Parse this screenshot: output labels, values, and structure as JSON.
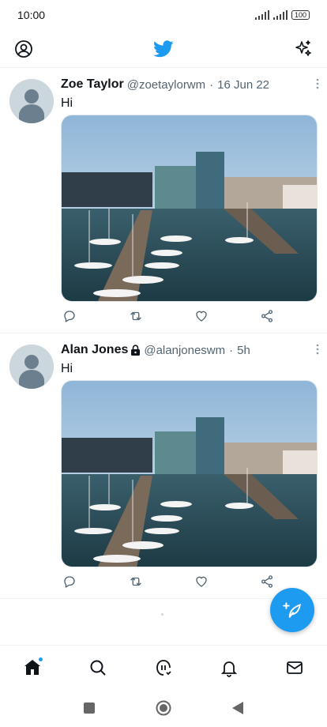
{
  "status_bar": {
    "time": "10:00",
    "battery": "100",
    "icons": [
      "signal-icon",
      "signal-icon",
      "battery-icon"
    ]
  },
  "app_bar": {
    "left_icon": "profile-icon",
    "center_icon": "twitter-bird-icon",
    "right_icon": "sparkle-icon"
  },
  "tweets": [
    {
      "name": "Zoe Taylor",
      "handle": "@zoetaylorwm",
      "dot": "·",
      "time": "16 Jun 22",
      "text": "Hi",
      "locked": false,
      "media": "harbor-photo"
    },
    {
      "name": "Alan Jones",
      "handle": "@alanjoneswm",
      "dot": "·",
      "time": "5h",
      "text": "Hi",
      "locked": true,
      "media": "harbor-photo"
    }
  ],
  "actions": [
    "reply-icon",
    "retweet-icon",
    "like-icon",
    "share-icon"
  ],
  "fab": {
    "icon": "compose-icon"
  },
  "tab_bar": {
    "items": [
      "home-icon",
      "search-icon",
      "spaces-icon",
      "notifications-icon",
      "messages-icon"
    ]
  },
  "system_nav": [
    "recents-icon",
    "home-circle-icon",
    "back-icon"
  ],
  "colors": {
    "accent": "#1d9bf0",
    "text": "#0f1419",
    "secondary": "#536471"
  }
}
